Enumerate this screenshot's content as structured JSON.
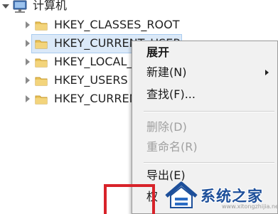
{
  "tree": {
    "root_label": "计算机",
    "keys": [
      {
        "label": "HKEY_CLASSES_ROOT",
        "selected": false
      },
      {
        "label": "HKEY_CURRENT_USER",
        "selected": true
      },
      {
        "label": "HKEY_LOCAL_MACHINE",
        "selected": false
      },
      {
        "label": "HKEY_USERS",
        "selected": false
      },
      {
        "label": "HKEY_CURRENT_CONFIG",
        "selected": false
      }
    ]
  },
  "context_menu": {
    "items": [
      {
        "label": "展开",
        "state": "bold"
      },
      {
        "label": "新建(N)",
        "state": "enabled",
        "submenu": true
      },
      {
        "label": "查找(F)...",
        "state": "enabled"
      },
      {
        "label": "删除(D)",
        "state": "disabled"
      },
      {
        "label": "重命名(R)",
        "state": "disabled"
      },
      {
        "label": "导出(E)",
        "state": "enabled"
      },
      {
        "label": "权",
        "state": "enabled"
      }
    ]
  },
  "watermark": {
    "text": "系统之家",
    "url": "www.xitongzhijia.net"
  },
  "colors": {
    "selection": "#dbe9f8",
    "highlight_box": "#d8232a",
    "watermark_text": "#1d4f9a",
    "folder": "#e9c35a"
  }
}
